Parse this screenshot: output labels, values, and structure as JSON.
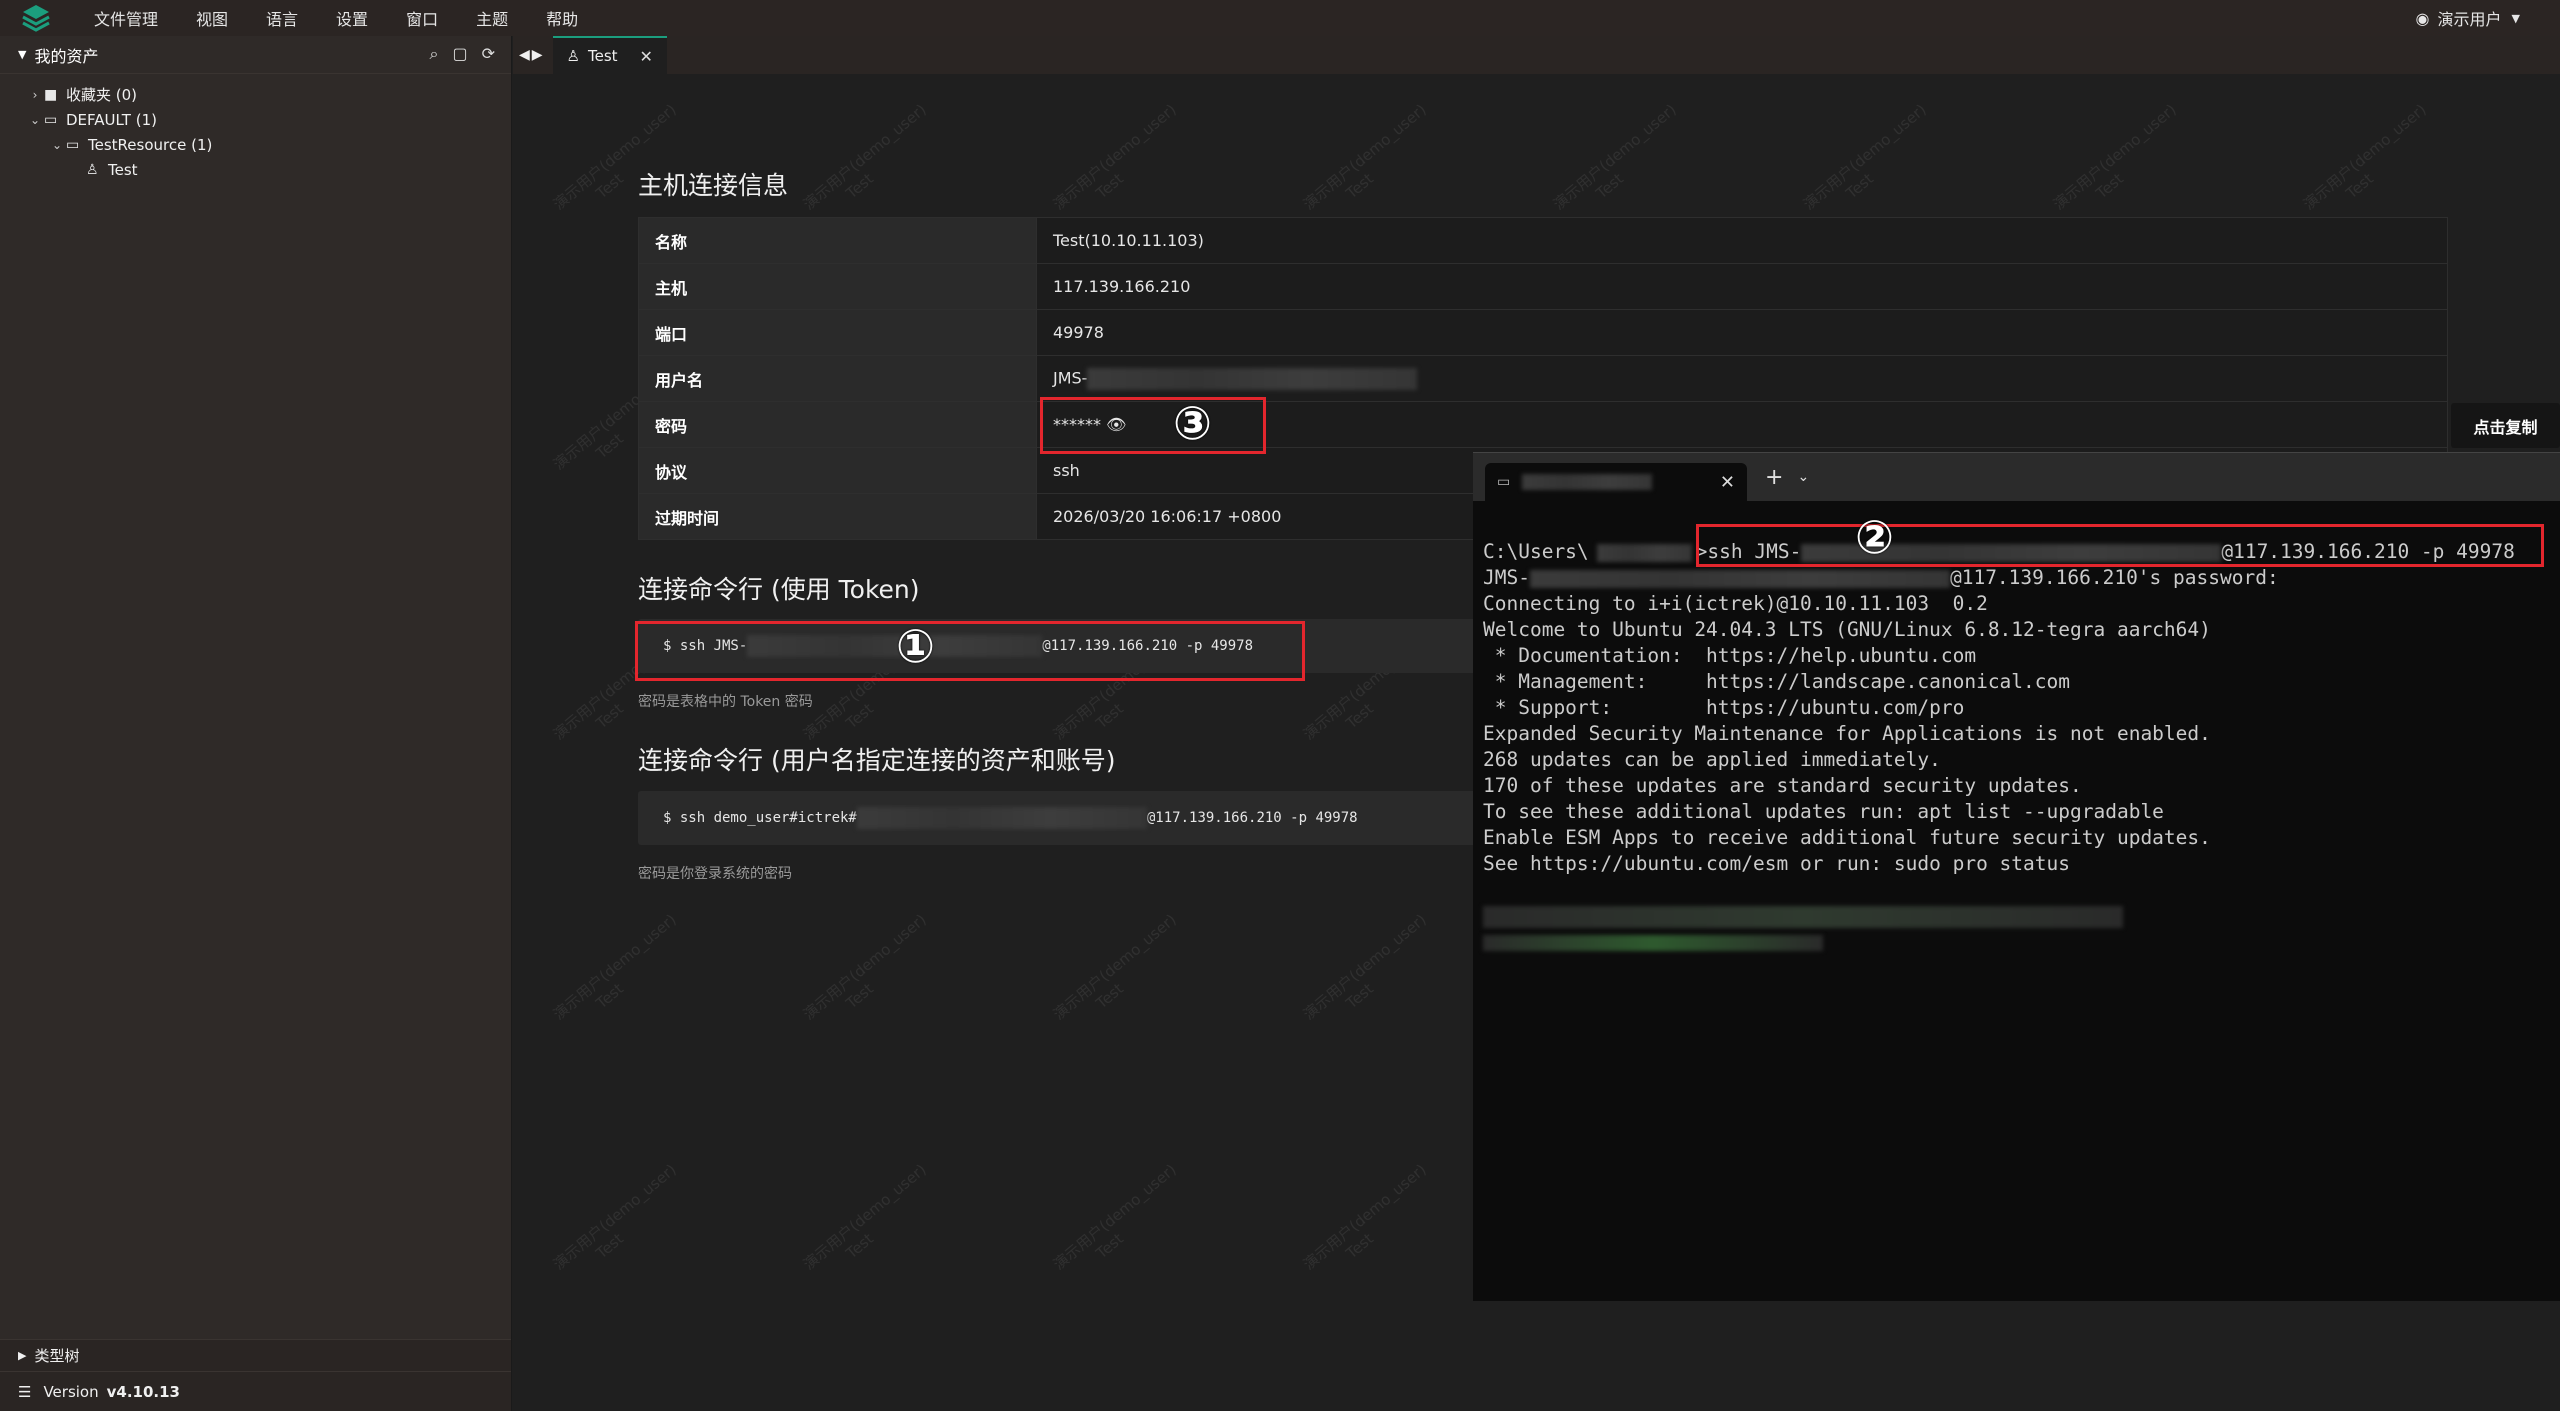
{
  "menu": [
    "文件管理",
    "视图",
    "语言",
    "设置",
    "窗口",
    "主题",
    "帮助"
  ],
  "user": {
    "name": "演示用户"
  },
  "sidebar": {
    "title": "我的资产",
    "tree": [
      {
        "label": "收藏夹 (0)"
      },
      {
        "label": "DEFAULT (1)"
      },
      {
        "label": "TestResource (1)"
      },
      {
        "label": "Test"
      }
    ],
    "type_tree": "类型树",
    "version_label": "Version",
    "version_value": "v4.10.13"
  },
  "tabs": [
    {
      "label": "Test"
    }
  ],
  "host_info": {
    "title": "主机连接信息",
    "rows": [
      {
        "key": "名称",
        "value": "Test(10.10.11.103)"
      },
      {
        "key": "主机",
        "value": "117.139.166.210"
      },
      {
        "key": "端口",
        "value": "49978"
      },
      {
        "key": "用户名",
        "value": "JMS-"
      },
      {
        "key": "密码",
        "value": "******"
      },
      {
        "key": "协议",
        "value": "ssh"
      },
      {
        "key": "过期时间",
        "value": "2026/03/20 16:06:17 +0800"
      }
    ]
  },
  "token_cmd": {
    "title": "连接命令行 (使用 Token)",
    "prefix": "$ ssh JMS-",
    "suffix": "@117.139.166.210 -p 49978",
    "hint": "密码是表格中的 Token 密码"
  },
  "user_cmd": {
    "title": "连接命令行 (用户名指定连接的资产和账号)",
    "prefix": "$ ssh demo_user#ictrek#",
    "suffix": "@117.139.166.210 -p 49978",
    "hint": "密码是你登录系统的密码"
  },
  "copy_button": "点击复制",
  "annotations": {
    "one": "①",
    "two": "②",
    "three": "③"
  },
  "watermark": {
    "line1": "演示用户(demo_user)",
    "line2": "Test"
  },
  "terminal": {
    "lines": [
      "C:\\Users\\",
      "JMS-",
      "Connecting to i+i(ictrek)@10.10.11.103  0.2",
      "Welcome to Ubuntu 24.04.3 LTS (GNU/Linux 6.8.12-tegra aarch64)",
      "",
      " * Documentation:  https://help.ubuntu.com",
      " * Management:     https://landscape.canonical.com",
      " * Support:        https://ubuntu.com/pro",
      "",
      "Expanded Security Maintenance for Applications is not enabled.",
      "",
      "268 updates can be applied immediately.",
      "170 of these updates are standard security updates.",
      "To see these additional updates run: apt list --upgradable",
      "",
      "Enable ESM Apps to receive additional future security updates.",
      "See https://ubuntu.com/esm or run: sudo pro status"
    ],
    "cmd_prefix": ">ssh JMS-",
    "cmd_suffix": "@117.139.166.210 -p 49978",
    "pw_suffix": "@117.139.166.210's password:"
  }
}
